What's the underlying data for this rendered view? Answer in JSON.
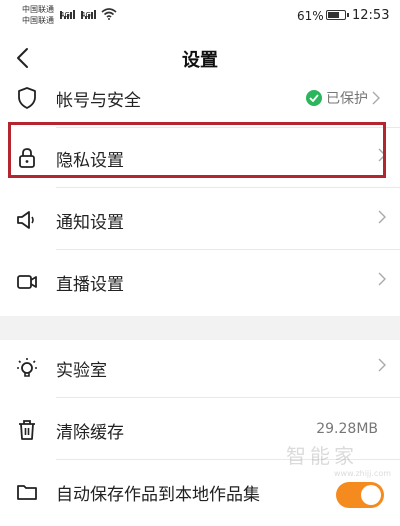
{
  "status_bar": {
    "carrier_1": "中国联通",
    "carrier_2": "中国联通",
    "signal_label_1": "4G",
    "signal_label_2": "4G",
    "battery_percent": "61%",
    "battery_level": 0.61,
    "time": "12:53"
  },
  "nav": {
    "title": "设置",
    "back_icon": "chevron-left-icon"
  },
  "settings": {
    "account": {
      "label": "帐号与安全",
      "status": "已保护",
      "icon": "shield-icon"
    },
    "privacy": {
      "label": "隐私设置",
      "icon": "lock-icon",
      "highlighted": true
    },
    "notifications": {
      "label": "通知设置",
      "icon": "speaker-icon"
    },
    "live": {
      "label": "直播设置",
      "icon": "video-camera-icon"
    },
    "lab": {
      "label": "实验室",
      "icon": "lightbulb-icon"
    },
    "cache": {
      "label": "清除缓存",
      "value": "29.28MB",
      "icon": "trash-icon"
    },
    "autosave": {
      "label": "自动保存作品到本地作品集",
      "icon": "folder-icon",
      "enabled": true
    }
  },
  "watermark": {
    "text": "智能家",
    "url": "www.zhijj.com"
  },
  "colors": {
    "accent_toggle": "#f58a1f",
    "protected_check": "#2db55d",
    "highlight_box": "#b3262f",
    "section_gap": "#f2f2f2"
  }
}
